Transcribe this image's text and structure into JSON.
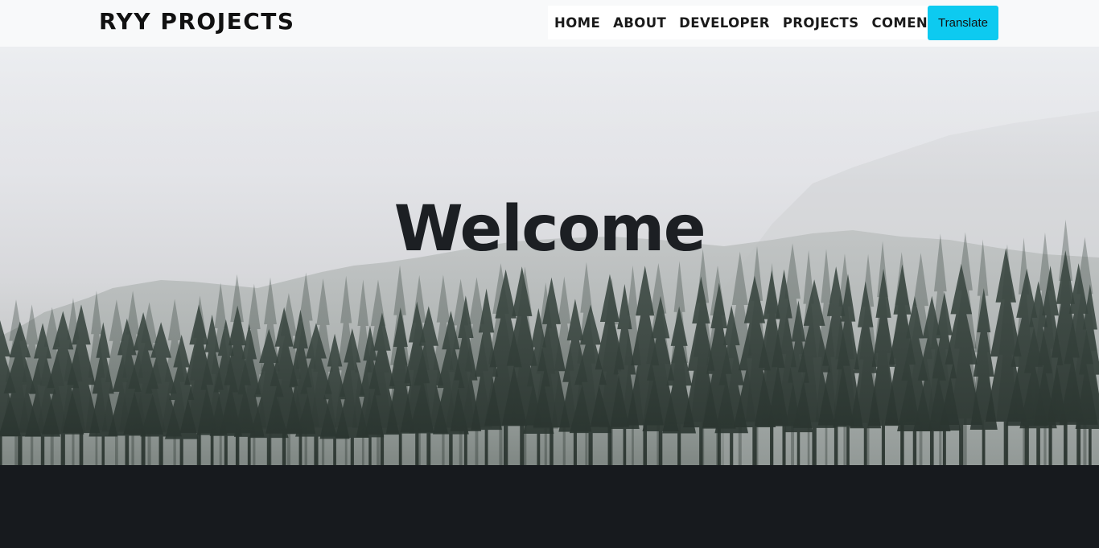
{
  "navbar": {
    "brand": "RYY PROJECTS",
    "links": [
      "HOME",
      "ABOUT",
      "DEVELOPER",
      "PROJECTS",
      "COMENT"
    ],
    "translate_label": "Translate",
    "translate_color": "#0dcaf0"
  },
  "hero": {
    "title": "Welcome",
    "background": "misty-pine-forest-image"
  },
  "colors": {
    "navbar_bg": "#f8f9fa",
    "footer_bg": "#171a1e",
    "title_color": "#1c1f23"
  }
}
